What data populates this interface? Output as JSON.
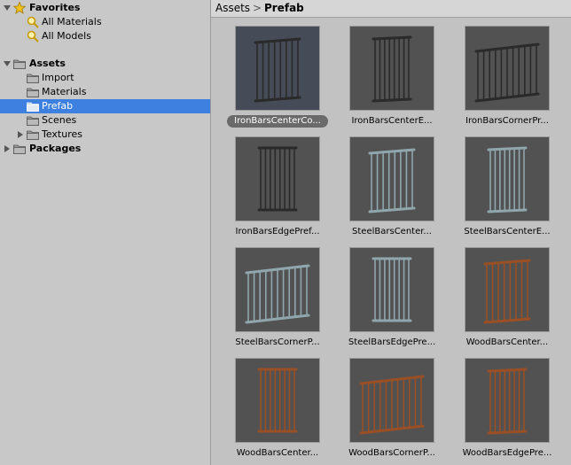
{
  "tree": {
    "favorites": {
      "label": "Favorites",
      "items": [
        "All Materials",
        "All Models"
      ]
    },
    "assets": {
      "label": "Assets",
      "items": [
        "Import",
        "Materials",
        "Prefab",
        "Scenes",
        "Textures"
      ],
      "selected": "Prefab"
    },
    "packages": {
      "label": "Packages"
    }
  },
  "breadcrumb": {
    "root": "Assets",
    "separator": ">",
    "current": "Prefab"
  },
  "prefabs": [
    {
      "label": "IronBarsCenterCo...",
      "material": "iron",
      "shape": "corner",
      "selected": true
    },
    {
      "label": "IronBarsCenterE...",
      "material": "iron",
      "shape": "edge"
    },
    {
      "label": "IronBarsCornerPr...",
      "material": "iron",
      "shape": "wide"
    },
    {
      "label": "IronBarsEdgePref...",
      "material": "iron",
      "shape": "flat"
    },
    {
      "label": "SteelBarsCenter...",
      "material": "steel",
      "shape": "corner"
    },
    {
      "label": "SteelBarsCenterE...",
      "material": "steel",
      "shape": "edge"
    },
    {
      "label": "SteelBarsCornerP...",
      "material": "steel",
      "shape": "wide"
    },
    {
      "label": "SteelBarsEdgePre...",
      "material": "steel",
      "shape": "flat"
    },
    {
      "label": "WoodBarsCenter...",
      "material": "wood",
      "shape": "corner"
    },
    {
      "label": "WoodBarsCenter...",
      "material": "wood",
      "shape": "flat"
    },
    {
      "label": "WoodBarsCornerP...",
      "material": "wood",
      "shape": "wide"
    },
    {
      "label": "WoodBarsEdgePre...",
      "material": "wood",
      "shape": "edge"
    }
  ],
  "colors": {
    "selection": "#3d80df",
    "iron": "#2a2a2a",
    "steel": "#8fa6ad",
    "wood": "#9a4f24"
  }
}
